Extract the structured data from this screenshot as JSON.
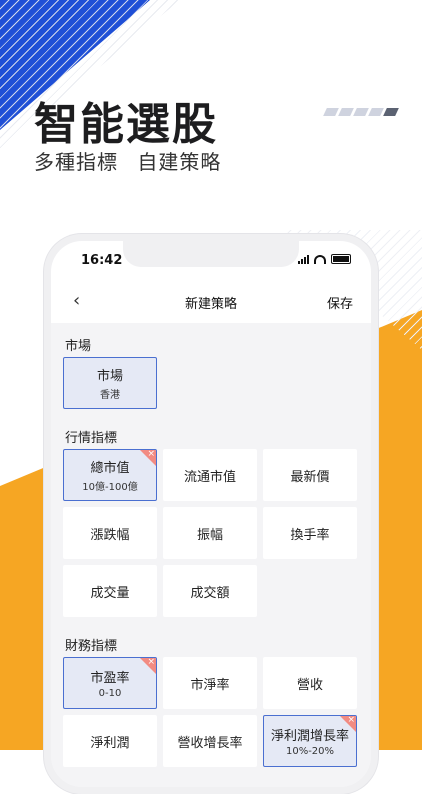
{
  "hero": {
    "title": "智能選股",
    "subtitle": "多種指標 自建策略"
  },
  "colors": {
    "blue": "#1f4fd6",
    "orange": "#f6a623",
    "selected_bg": "#e5e9f5",
    "selected_border": "#4a6fd0",
    "remove": "#f28b82"
  },
  "phone": {
    "status": {
      "time": "16:42",
      "icons": [
        "signal-icon",
        "wifi-icon",
        "battery-icon"
      ]
    },
    "nav": {
      "back_icon": "‹",
      "title": "新建策略",
      "save": "保存"
    },
    "sections": [
      {
        "title": "市場",
        "items": [
          {
            "label": "市場",
            "value": "香港",
            "selected": true,
            "removable": false
          }
        ]
      },
      {
        "title": "行情指標",
        "items": [
          {
            "label": "總市值",
            "value": "10億-100億",
            "selected": true,
            "removable": true
          },
          {
            "label": "流通市值",
            "selected": false
          },
          {
            "label": "最新價",
            "selected": false
          },
          {
            "label": "漲跌幅",
            "selected": false
          },
          {
            "label": "振幅",
            "selected": false
          },
          {
            "label": "換手率",
            "selected": false
          },
          {
            "label": "成交量",
            "selected": false
          },
          {
            "label": "成交額",
            "selected": false
          }
        ]
      },
      {
        "title": "財務指標",
        "items": [
          {
            "label": "市盈率",
            "value": "0-10",
            "selected": true,
            "removable": true
          },
          {
            "label": "市淨率",
            "selected": false
          },
          {
            "label": "營收",
            "selected": false
          },
          {
            "label": "淨利潤",
            "selected": false
          },
          {
            "label": "營收增長率",
            "selected": false
          },
          {
            "label": "淨利潤增長率",
            "value": "10%-20%",
            "selected": true,
            "removable": true
          }
        ]
      }
    ],
    "remove_icon": "×"
  }
}
